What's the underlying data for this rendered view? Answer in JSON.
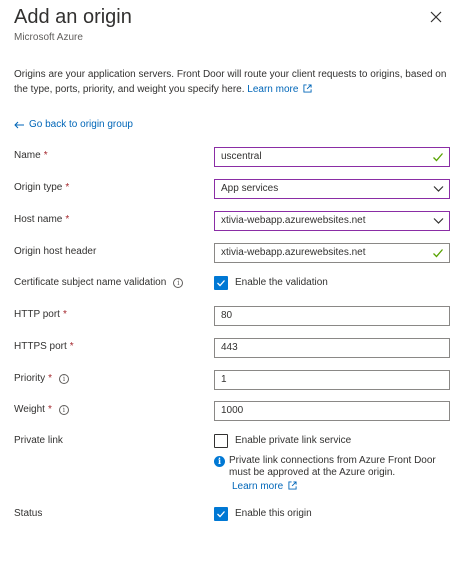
{
  "header": {
    "title": "Add an origin",
    "subtitle": "Microsoft Azure"
  },
  "intro": {
    "text": "Origins are your application servers. Front Door will route your client requests to origins, based on the type, ports, priority, and weight you specify here.",
    "learn_more": "Learn more"
  },
  "back_link": "Go back to origin group",
  "fields": {
    "name": {
      "label": "Name",
      "required": "*",
      "value": "uscentral"
    },
    "origin_type": {
      "label": "Origin type",
      "required": "*",
      "value": "App services"
    },
    "host_name": {
      "label": "Host name",
      "required": "*",
      "value": "xtivia-webapp.azurewebsites.net"
    },
    "origin_host_header": {
      "label": "Origin host header",
      "value": "xtivia-webapp.azurewebsites.net"
    },
    "cert_validation": {
      "label": "Certificate subject name validation",
      "checkbox_label": "Enable the validation",
      "checked": true
    },
    "http_port": {
      "label": "HTTP port",
      "required": "*",
      "value": "80"
    },
    "https_port": {
      "label": "HTTPS port",
      "required": "*",
      "value": "443"
    },
    "priority": {
      "label": "Priority",
      "required": "*",
      "value": "1"
    },
    "weight": {
      "label": "Weight",
      "required": "*",
      "value": "1000"
    },
    "private_link": {
      "label": "Private link",
      "checkbox_label": "Enable private link service",
      "checked": false,
      "info": "Private link connections from Azure Front Door must be approved at the Azure origin.",
      "learn_more": "Learn more"
    },
    "status": {
      "label": "Status",
      "checkbox_label": "Enable this origin",
      "checked": true
    }
  },
  "colors": {
    "accent": "#0078d4",
    "link": "#0066b8",
    "focus_border": "#8a2da5",
    "valid_check": "#57a300",
    "required": "#a4262c"
  }
}
